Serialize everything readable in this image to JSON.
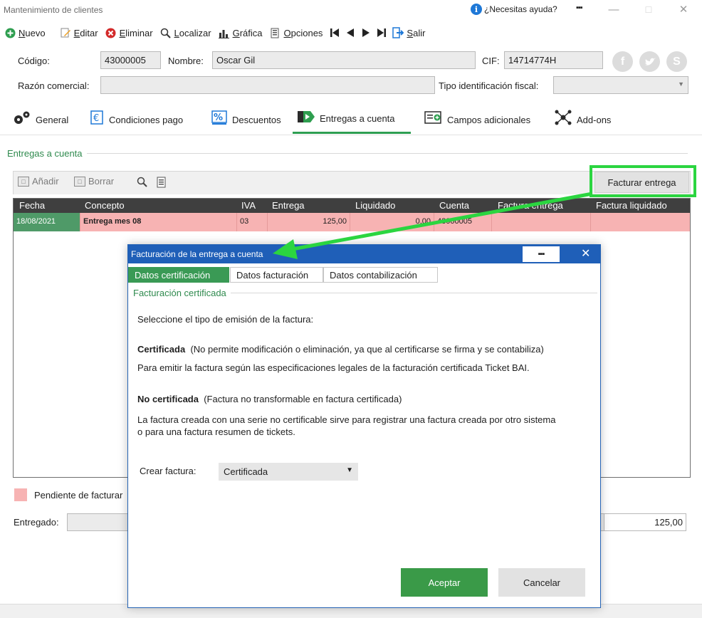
{
  "window": {
    "title": "Mantenimiento de clientes",
    "help_label": "¿Necesitas ayuda?",
    "more_label": "▪▪▪"
  },
  "toolbar": {
    "nuevo_prefix": "",
    "nuevo_mnemonic": "N",
    "nuevo_rest": "uevo",
    "editar_mnemonic": "E",
    "editar_rest": "ditar",
    "eliminar_mnemonic": "E",
    "eliminar_rest": "liminar",
    "localizar_mnemonic": "L",
    "localizar_rest": "ocalizar",
    "grafica_mnemonic": "G",
    "grafica_rest": "ráfica",
    "opciones_mnemonic": "O",
    "opciones_rest": "pciones",
    "salir_mnemonic": "S",
    "salir_rest": "alir"
  },
  "form": {
    "codigo_label": "Código:",
    "codigo_value": "43000005",
    "nombre_label": "Nombre:",
    "nombre_value": "Oscar Gil",
    "cif_label": "CIF:",
    "cif_value": "14714774H",
    "razon_label": "Razón comercial:",
    "razon_value": "",
    "tipo_label": "Tipo identificación fiscal:",
    "tipo_value": ""
  },
  "tabs": [
    {
      "label": "General"
    },
    {
      "label": "Condiciones pago"
    },
    {
      "label": "Descuentos"
    },
    {
      "label": "Entregas a cuenta"
    },
    {
      "label": "Campos adicionales"
    },
    {
      "label": "Add-ons"
    }
  ],
  "section": {
    "title": "Entregas a cuenta"
  },
  "grid_toolbar": {
    "anadir": "Añadir",
    "borrar": "Borrar",
    "facturar": "Facturar entrega"
  },
  "grid": {
    "columns": [
      "Fecha",
      "Concepto",
      "IVA",
      "Entrega",
      "Liquidado",
      "Cuenta",
      "Factura entrega",
      "Factura liquidado"
    ],
    "rows": [
      {
        "fecha": "18/08/2021",
        "concepto": "Entrega mes 08",
        "iva": "03",
        "entrega": "125,00",
        "liquidado": "0,00",
        "cuenta": "43000005",
        "factura_entrega": "",
        "factura_liquidado": ""
      }
    ]
  },
  "legend": {
    "label": "Pendiente de facturar"
  },
  "totals": {
    "entregado_label": "Entregado:",
    "entregado_value": "125,00"
  },
  "modal": {
    "title": "Facturación de la entrega a cuenta",
    "more_label": "▪▪▪",
    "tabs": [
      "Datos certificación",
      "Datos facturación",
      "Datos contabilización"
    ],
    "section": "Facturación certificada",
    "intro": "Seleccione el tipo de emisión de la factura:",
    "cert_title": "Certificada",
    "cert_desc": "(No permite modificación o eliminación, ya que al certificarse se firma y se contabiliza)",
    "cert_detail": "Para emitir la factura según las especificaciones legales de la facturación certificada Ticket BAI.",
    "nocert_title": "No certificada",
    "nocert_desc": "(Factura no transformable en factura certificada)",
    "nocert_detail_1": "La factura creada con una serie no certificable sirve para registrar una factura creada por otro sistema",
    "nocert_detail_2": "o para una factura resumen de tickets.",
    "crear_label": "Crear factura:",
    "crear_value": "Certificada",
    "aceptar": "Aceptar",
    "cancelar": "Cancelar"
  },
  "colors": {
    "accent_green": "#3a9a48",
    "highlight_green": "#2bd540",
    "modal_blue": "#1f5fb8",
    "pending_pink": "#f7b3b3",
    "grid_header": "#3f3f3f"
  }
}
